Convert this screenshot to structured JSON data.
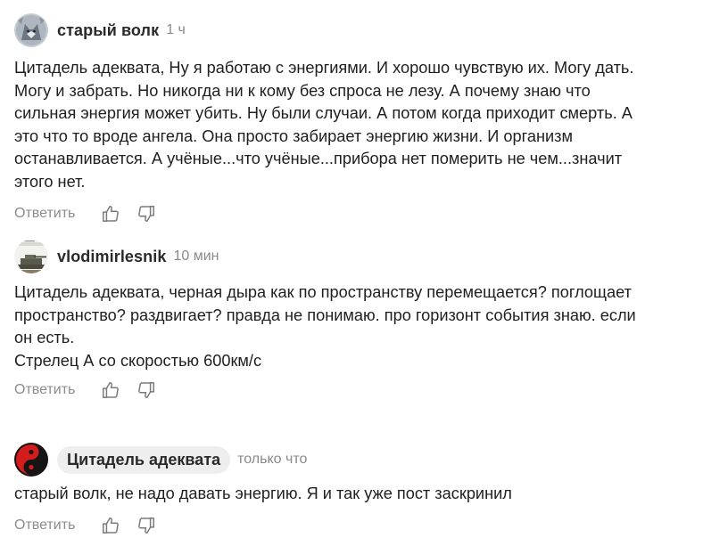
{
  "comments": [
    {
      "author": "старый волк",
      "time": "1 ч",
      "text": "Цитадель адеквата, Ну я работаю с энергиями. И хорошо чувствую их. Могу дать.\nМогу и забрать. Но никогда ни к кому без спроса не лезу. А почему знаю что\nсильная энергия может убить. Ну были случаи. А потом когда приходит смерть. А\nэто что то вроде ангела. Она просто забирает энергию жизни. И организм\nостанавливается. А учёные...что учёные...прибора нет померить не чем...значит\nэтого нет.",
      "reply_label": "Ответить"
    },
    {
      "author": "vlodimirlesnik",
      "time": "10 мин",
      "text": "Цитадель адеквата, черная дыра как по пространству перемещается? поглощает\nпространство? раздвигает? правда не понимаю. про горизонт события знаю. если\nон есть.\nСтрелец А со скоростью 600км/с",
      "reply_label": "Ответить"
    },
    {
      "author": "Цитадель адеквата",
      "time": "только что",
      "text": "старый волк, не надо давать энергию. Я и так уже пост заскринил",
      "reply_label": "Ответить"
    }
  ],
  "icons": {
    "like": "thumbs-up-icon",
    "dislike": "thumbs-down-icon"
  },
  "colors": {
    "text": "#1f1f1f",
    "muted": "#8a8a8a",
    "chip": "#eeeeee",
    "avatar_red": "#d41c1c"
  }
}
